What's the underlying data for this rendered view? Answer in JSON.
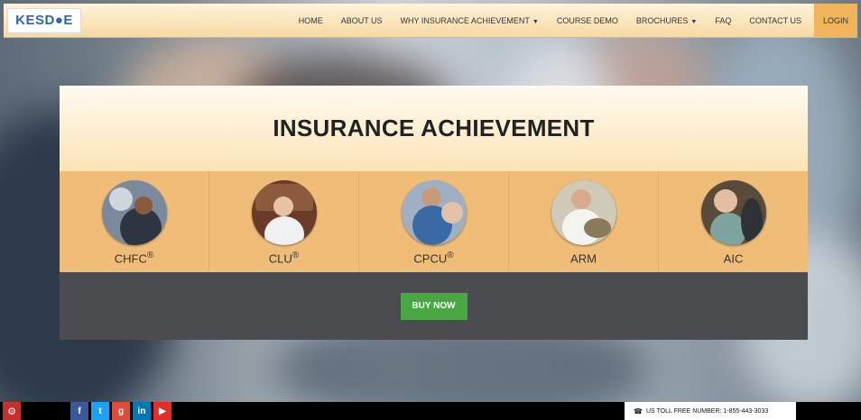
{
  "logo": {
    "text": "KESD●E"
  },
  "nav": {
    "items": [
      {
        "label": "HOME",
        "dropdown": false
      },
      {
        "label": "ABOUT US",
        "dropdown": false
      },
      {
        "label": "WHY INSURANCE ACHIEVEMENT",
        "dropdown": true
      },
      {
        "label": "COURSE DEMO",
        "dropdown": false
      },
      {
        "label": "BROCHURES",
        "dropdown": true
      },
      {
        "label": "FAQ",
        "dropdown": false
      },
      {
        "label": "CONTACT US",
        "dropdown": false
      }
    ],
    "login_label": "LOGIN"
  },
  "hero": {
    "title": "INSURANCE ACHIEVEMENT",
    "courses": [
      {
        "name": "CHFC",
        "mark": "®"
      },
      {
        "name": "CLU",
        "mark": "®"
      },
      {
        "name": "CPCU",
        "mark": "®"
      },
      {
        "name": "ARM",
        "mark": ""
      },
      {
        "name": "AIC",
        "mark": ""
      }
    ],
    "buy_label": "BUY NOW"
  },
  "footer": {
    "social": [
      {
        "icon": "facebook-icon",
        "glyph": "f",
        "color": "#3b5998"
      },
      {
        "icon": "twitter-icon",
        "glyph": "t",
        "color": "#1da1f2"
      },
      {
        "icon": "google-plus-icon",
        "glyph": "g",
        "color": "#dd4b39"
      },
      {
        "icon": "linkedin-icon",
        "glyph": "in",
        "color": "#0077b5"
      },
      {
        "icon": "youtube-icon",
        "glyph": "▶",
        "color": "#e52d27"
      }
    ],
    "toll_free": "US TOLL FREE NUMBER: 1-855-443-3033"
  },
  "colors": {
    "nav_bg": "#f7d9a2",
    "login_bg": "#f0b45b",
    "course_row_bg": "#efbd78",
    "buy_button": "#49a843",
    "buy_row_bg": "#4a4c50"
  }
}
